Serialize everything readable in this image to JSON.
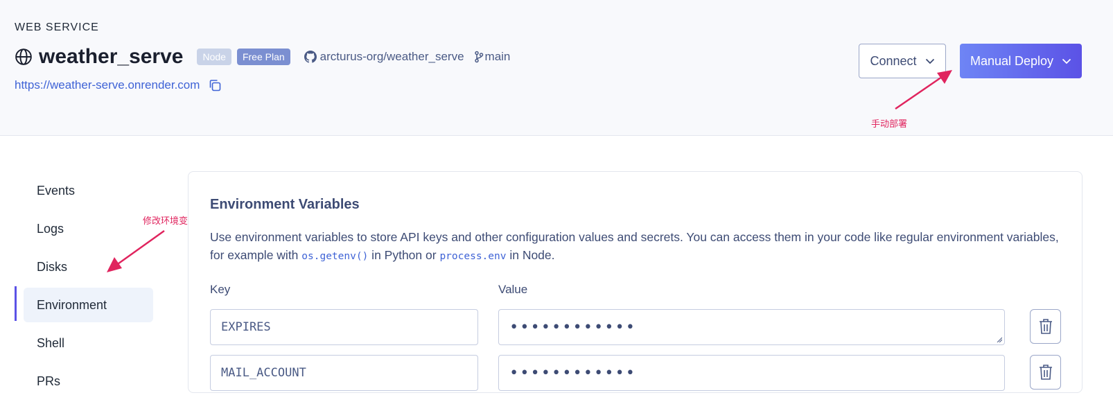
{
  "header": {
    "service_type": "WEB SERVICE",
    "service_name": "weather_serve",
    "badges": {
      "runtime": "Node",
      "plan": "Free Plan"
    },
    "repo": "arcturus-org/weather_serve",
    "branch": "main",
    "url": "https://weather-serve.onrender.com",
    "connect_label": "Connect",
    "deploy_label": "Manual Deploy"
  },
  "annotations": {
    "deploy_note": "手动部署",
    "env_note": "修改环境变量"
  },
  "sidebar": {
    "items": [
      {
        "label": "Events",
        "active": false
      },
      {
        "label": "Logs",
        "active": false
      },
      {
        "label": "Disks",
        "active": false
      },
      {
        "label": "Environment",
        "active": true
      },
      {
        "label": "Shell",
        "active": false
      },
      {
        "label": "PRs",
        "active": false
      }
    ]
  },
  "env_panel": {
    "title": "Environment Variables",
    "desc_part1": "Use environment variables to store API keys and other configuration values and secrets. You can access them in your code like regular environment variables, for example with ",
    "code1": "os.getenv()",
    "desc_part2": " in Python or ",
    "code2": "process.env",
    "desc_part3": " in Node.",
    "key_label": "Key",
    "value_label": "Value",
    "rows": [
      {
        "key": "EXPIRES",
        "value": "••••••••••••"
      },
      {
        "key": "MAIL_ACCOUNT",
        "value": "••••••••••••"
      }
    ]
  },
  "colors": {
    "accent": "#5b52e6",
    "link": "#3f63d6",
    "annotation": "#e0245e"
  }
}
